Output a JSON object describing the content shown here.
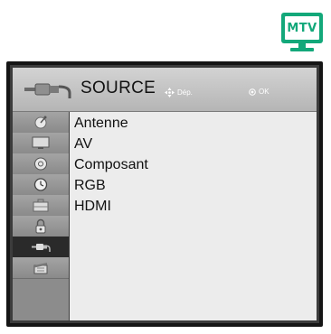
{
  "badge": {
    "text": "MTV",
    "color": "#13a87a"
  },
  "header": {
    "title": "SOURCE",
    "icon": "source-connector-icon",
    "nav_hint": "Dép.",
    "ok_hint": "OK"
  },
  "sidebar": {
    "items": [
      {
        "icon": "antenna-dish-icon"
      },
      {
        "icon": "tv-screen-icon"
      },
      {
        "icon": "audio-disc-icon"
      },
      {
        "icon": "clock-icon"
      },
      {
        "icon": "briefcase-icon"
      },
      {
        "icon": "lock-icon"
      },
      {
        "icon": "input-connector-icon",
        "active": true
      },
      {
        "icon": "clapperboard-icon"
      }
    ]
  },
  "menu": {
    "items": [
      "Antenne",
      "AV",
      "Composant",
      "RGB",
      "HDMI"
    ]
  }
}
